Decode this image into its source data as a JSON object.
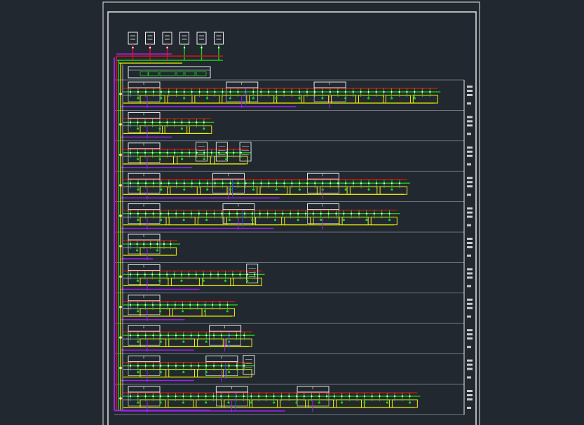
{
  "colors": {
    "background": "#212830",
    "frame": "#e6e6e6",
    "row_divider": "#8a8f96",
    "device_box": "#f0f0f0",
    "bus_red": "#e01010",
    "bus_green": "#14d414",
    "bus_yellow": "#f0f000",
    "bus_purple": "#a020f0",
    "bus_blue": "#3c46ff",
    "bus_white": "#ffffff",
    "node_dot": "#ffffff"
  },
  "top_devices": {
    "count": 6
  },
  "header_panel": {
    "present": true
  },
  "floor_rows": [
    {
      "extent": 0.93,
      "boxes": [
        0.0,
        0.29,
        0.55
      ],
      "bars": 11
    },
    {
      "extent": 0.26,
      "boxes": [
        0.0
      ],
      "bars": 3
    },
    {
      "extent": 0.37,
      "boxes": [
        0.0
      ],
      "devices": [
        0.2,
        0.26,
        0.33
      ],
      "bars": 3
    },
    {
      "extent": 0.84,
      "boxes": [
        0.0,
        0.25,
        0.53
      ],
      "bars": 9
    },
    {
      "extent": 0.81,
      "boxes": [
        0.0,
        0.28,
        0.53
      ],
      "bars": 9
    },
    {
      "extent": 0.16,
      "boxes": [
        0.0
      ],
      "bars": 1
    },
    {
      "extent": 0.41,
      "boxes": [
        0.0
      ],
      "devices": [
        0.35
      ],
      "bars": 4
    },
    {
      "extent": 0.33,
      "boxes": [
        0.0
      ],
      "bars": 3
    },
    {
      "extent": 0.38,
      "boxes": [
        0.0,
        0.24
      ],
      "bars": 4
    },
    {
      "extent": 0.38,
      "boxes": [
        0.0,
        0.23
      ],
      "devices": [
        0.34
      ],
      "bars": 4
    },
    {
      "extent": 0.87,
      "boxes": [
        0.0,
        0.26,
        0.5
      ],
      "bars": 10
    }
  ]
}
